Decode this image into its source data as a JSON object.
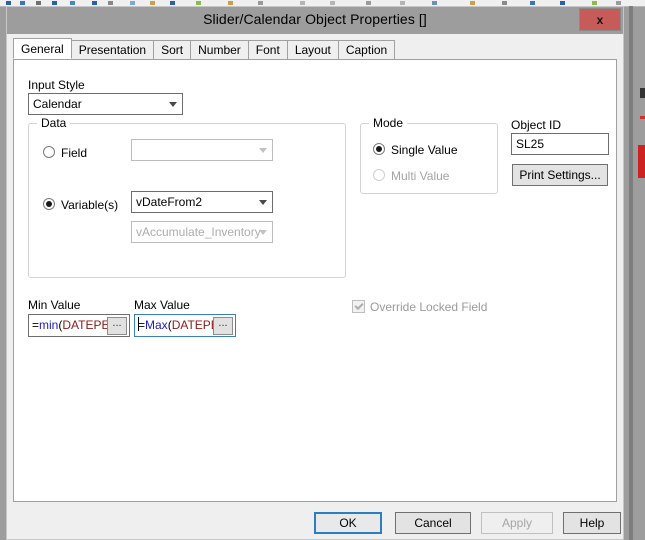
{
  "window": {
    "title": "Slider/Calendar Object Properties []",
    "close_label": "x"
  },
  "tabs": [
    {
      "label": "General",
      "active": true
    },
    {
      "label": "Presentation",
      "active": false
    },
    {
      "label": "Sort",
      "active": false
    },
    {
      "label": "Number",
      "active": false
    },
    {
      "label": "Font",
      "active": false
    },
    {
      "label": "Layout",
      "active": false
    },
    {
      "label": "Caption",
      "active": false
    }
  ],
  "general": {
    "input_style": {
      "label": "Input Style",
      "value": "Calendar"
    },
    "data_group": {
      "title": "Data",
      "field_radio": {
        "label": "Field",
        "checked": false
      },
      "field_combo": {
        "value": "",
        "disabled": true
      },
      "variable_radio": {
        "label": "Variable(s)",
        "checked": true
      },
      "variable_combo": {
        "value": "vDateFrom2",
        "disabled": false
      },
      "variable_combo2": {
        "value": "vAccumulate_Inventory",
        "disabled": true
      }
    },
    "mode_group": {
      "title": "Mode",
      "single_value": {
        "label": "Single Value",
        "checked": true
      },
      "multi_value": {
        "label": "Multi Value",
        "checked": false,
        "disabled": true
      }
    },
    "object_id": {
      "label": "Object ID",
      "value": "SL25"
    },
    "print_settings_button": "Print Settings...",
    "min_value": {
      "label": "Min Value",
      "op": "=",
      "fn": "min",
      "paren": "(",
      "ident": "DATEPE",
      "ellipsis": "...",
      "focused": false
    },
    "max_value": {
      "label": "Max Value",
      "op": "=",
      "fn": "Max",
      "paren": "(",
      "ident": "DATEPE",
      "ellipsis": "...",
      "focused": true
    },
    "override_locked_field": {
      "label": "Override Locked Field",
      "checked": true,
      "disabled": true
    }
  },
  "footer": {
    "ok": "OK",
    "cancel": "Cancel",
    "apply": "Apply",
    "help": "Help"
  },
  "colors": {
    "titlebar": "#9d9d9d",
    "close_button": "#c75b58",
    "dialog_face": "#efefef",
    "page_face": "#ffffff",
    "focus_blue": "#2b7ec1",
    "expr_function": "#1c1cbd",
    "expr_identifier": "#8b1a1a"
  }
}
